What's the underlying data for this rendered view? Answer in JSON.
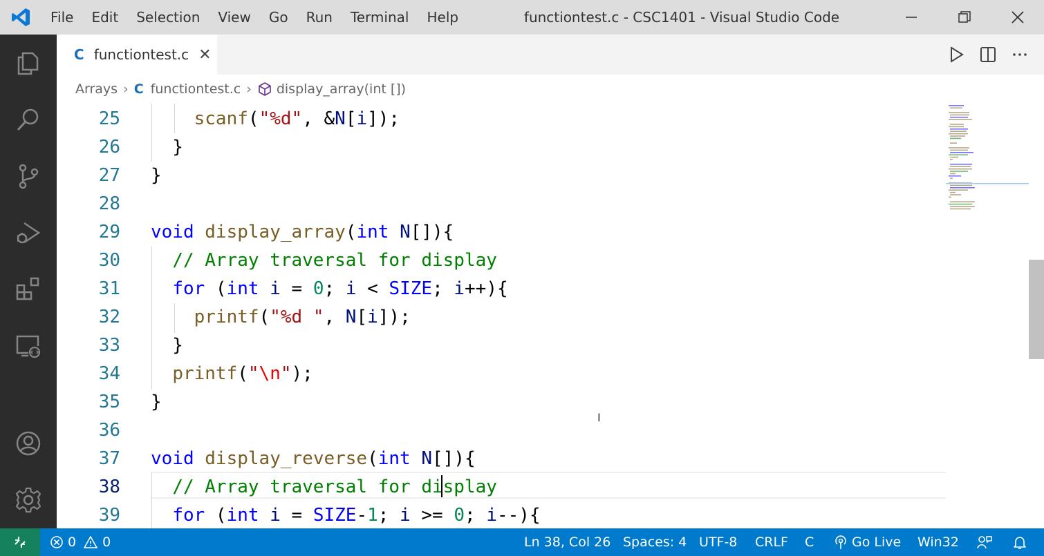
{
  "window": {
    "title": "functiontest.c - CSC1401 - Visual Studio Code",
    "menu": [
      "File",
      "Edit",
      "Selection",
      "View",
      "Go",
      "Run",
      "Terminal",
      "Help"
    ]
  },
  "tab": {
    "lang_icon": "C",
    "name": "functiontest.c",
    "close": "✕"
  },
  "breadcrumb": {
    "folder": "Arrays",
    "lang_icon": "C",
    "file": "functiontest.c",
    "symbol": "display_array(int [])"
  },
  "editor": {
    "line_numbers": [
      "25",
      "26",
      "27",
      "28",
      "29",
      "30",
      "31",
      "32",
      "33",
      "34",
      "35",
      "36",
      "37",
      "38",
      "39"
    ],
    "active_line": "38",
    "lines": [
      [
        [
          "    ",
          ""
        ],
        [
          "scanf",
          "fn"
        ],
        [
          "(",
          ""
        ],
        [
          "\"%d\"",
          "str"
        ],
        [
          ", &",
          ""
        ],
        [
          "N",
          "var"
        ],
        [
          "[",
          ""
        ],
        [
          "i",
          "var"
        ],
        [
          "]);",
          ""
        ]
      ],
      [
        [
          "  }",
          ""
        ]
      ],
      [
        [
          "}",
          ""
        ]
      ],
      [],
      [
        [
          "void",
          "kw"
        ],
        [
          " ",
          ""
        ],
        [
          "display_array",
          "fn"
        ],
        [
          "(",
          ""
        ],
        [
          "int",
          "kw"
        ],
        [
          " ",
          ""
        ],
        [
          "N",
          "var"
        ],
        [
          "[]){",
          ""
        ]
      ],
      [
        [
          "  ",
          ""
        ],
        [
          "// Array traversal for display",
          "cm"
        ]
      ],
      [
        [
          "  ",
          ""
        ],
        [
          "for",
          "kw"
        ],
        [
          " (",
          ""
        ],
        [
          "int",
          "kw"
        ],
        [
          " ",
          ""
        ],
        [
          "i",
          "var"
        ],
        [
          " = ",
          ""
        ],
        [
          "0",
          "num"
        ],
        [
          "; ",
          ""
        ],
        [
          "i",
          "var"
        ],
        [
          " < ",
          ""
        ],
        [
          "SIZE",
          "mac"
        ],
        [
          "; ",
          ""
        ],
        [
          "i",
          "var"
        ],
        [
          "++){",
          ""
        ]
      ],
      [
        [
          "    ",
          ""
        ],
        [
          "printf",
          "fn"
        ],
        [
          "(",
          ""
        ],
        [
          "\"%d \"",
          "str"
        ],
        [
          ", ",
          ""
        ],
        [
          "N",
          "var"
        ],
        [
          "[",
          ""
        ],
        [
          "i",
          "var"
        ],
        [
          "]);",
          ""
        ]
      ],
      [
        [
          "  }",
          ""
        ]
      ],
      [
        [
          "  ",
          ""
        ],
        [
          "printf",
          "fn"
        ],
        [
          "(",
          ""
        ],
        [
          "\"",
          "str"
        ],
        [
          "\\n",
          "esc"
        ],
        [
          "\"",
          "str"
        ],
        [
          ");",
          ""
        ]
      ],
      [
        [
          "}",
          ""
        ]
      ],
      [],
      [
        [
          "void",
          "kw"
        ],
        [
          " ",
          ""
        ],
        [
          "display_reverse",
          "fn"
        ],
        [
          "(",
          ""
        ],
        [
          "int",
          "kw"
        ],
        [
          " ",
          ""
        ],
        [
          "N",
          "var"
        ],
        [
          "[]){",
          ""
        ]
      ],
      [
        [
          "  ",
          ""
        ],
        [
          "// Array traversal for display",
          "cm"
        ]
      ],
      [
        [
          "  ",
          ""
        ],
        [
          "for",
          "kw"
        ],
        [
          " (",
          ""
        ],
        [
          "int",
          "kw"
        ],
        [
          " ",
          ""
        ],
        [
          "i",
          "var"
        ],
        [
          " = ",
          ""
        ],
        [
          "SIZE",
          "mac"
        ],
        [
          "-",
          ""
        ],
        [
          "1",
          "num"
        ],
        [
          "; ",
          ""
        ],
        [
          "i",
          "var"
        ],
        [
          " >= ",
          ""
        ],
        [
          "0",
          "num"
        ],
        [
          "; ",
          ""
        ],
        [
          "i",
          "var"
        ],
        [
          "--){",
          ""
        ]
      ]
    ]
  },
  "status": {
    "errors": "0",
    "warnings": "0",
    "position": "Ln 38, Col 26",
    "spaces": "Spaces: 4",
    "encoding": "UTF-8",
    "eol": "CRLF",
    "language": "C",
    "golive": "Go Live",
    "platform": "Win32"
  },
  "colors": {
    "statusbar": "#007acc",
    "remote": "#16825d",
    "activitybar": "#2c2c2c",
    "titlebar": "#dddddd"
  },
  "icons": {
    "app": "vscode-logo-icon",
    "activity": [
      "explorer-icon",
      "search-icon",
      "source-control-icon",
      "run-debug-icon",
      "extensions-icon",
      "remote-explorer-icon",
      "accounts-icon",
      "manage-gear-icon"
    ],
    "editor_actions": [
      "run-icon",
      "split-editor-icon",
      "more-actions-icon"
    ]
  }
}
